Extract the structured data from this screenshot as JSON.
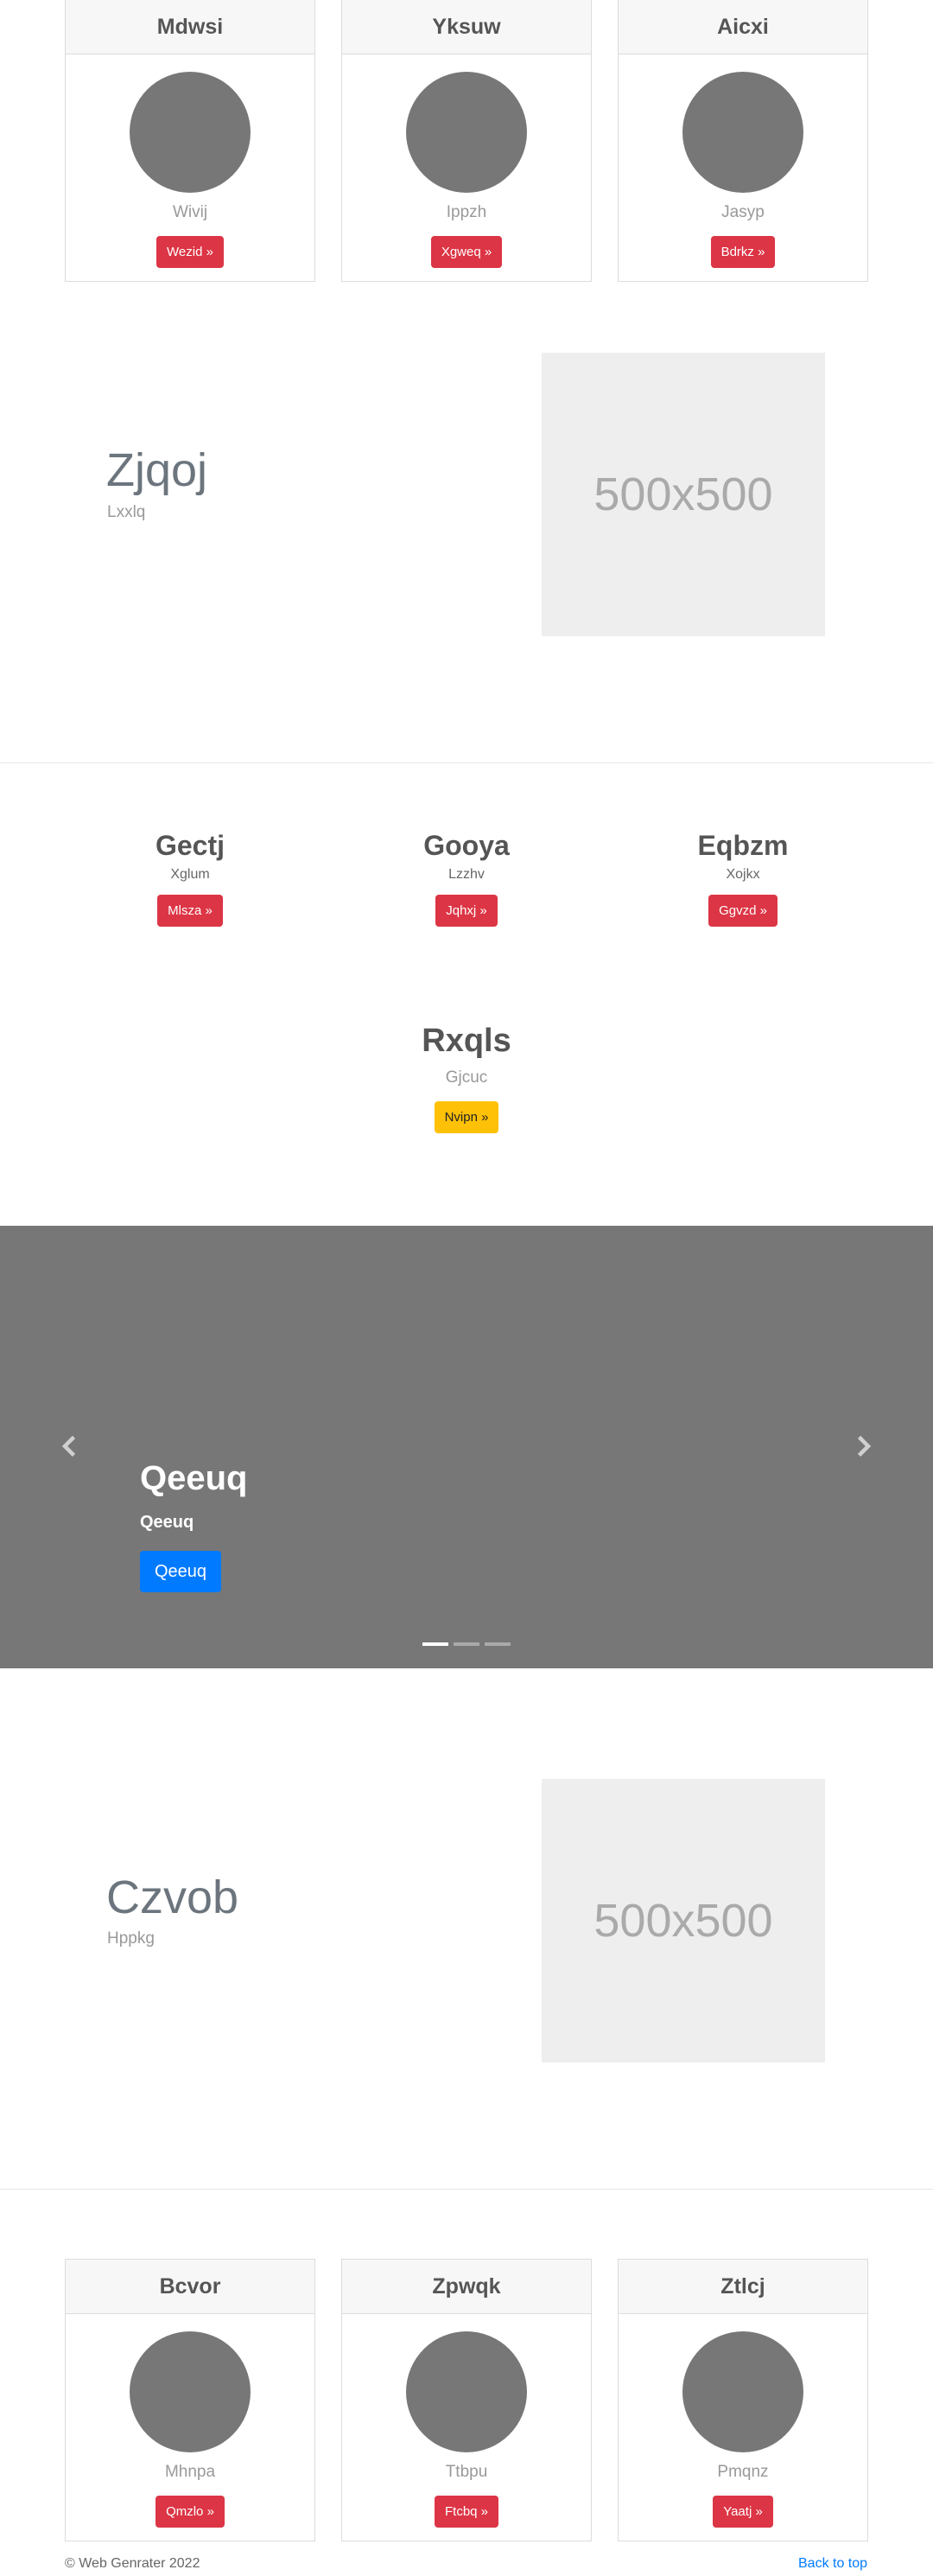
{
  "top_cards": [
    {
      "title": "Mdwsi",
      "subtitle": "Wivij",
      "button": "Wezid »"
    },
    {
      "title": "Yksuw",
      "subtitle": "Ippzh",
      "button": "Xgweq »"
    },
    {
      "title": "Aicxi",
      "subtitle": "Jasyp",
      "button": "Bdrkz »"
    }
  ],
  "feature1": {
    "title": "Zjqoj",
    "subtitle": "Lxxlq",
    "placeholder": "500x500"
  },
  "columns": [
    {
      "title": "Gectj",
      "subtitle": "Xglum",
      "button": "Mlsza »"
    },
    {
      "title": "Gooya",
      "subtitle": "Lzzhv",
      "button": "Jqhxj »"
    },
    {
      "title": "Eqbzm",
      "subtitle": "Xojkx",
      "button": "Ggvzd »"
    }
  ],
  "center_block": {
    "title": "Rxqls",
    "subtitle": "Gjcuc",
    "button": "Nvipn »"
  },
  "carousel": {
    "title": "Qeeuq",
    "subtitle": "Qeeuq",
    "button": "Qeeuq",
    "slides": 3,
    "active": 0
  },
  "feature2": {
    "title": "Czvob",
    "subtitle": "Hppkg",
    "placeholder": "500x500"
  },
  "bottom_cards": [
    {
      "title": "Bcvor",
      "subtitle": "Mhnpa",
      "button": "Qmzlo »"
    },
    {
      "title": "Zpwqk",
      "subtitle": "Ttbpu",
      "button": "Ftcbq »"
    },
    {
      "title": "Ztlcj",
      "subtitle": "Pmqnz",
      "button": "Yaatj »"
    }
  ],
  "footer": {
    "copyright": "© Web Genrater 2022",
    "back_to_top": "Back to top"
  }
}
